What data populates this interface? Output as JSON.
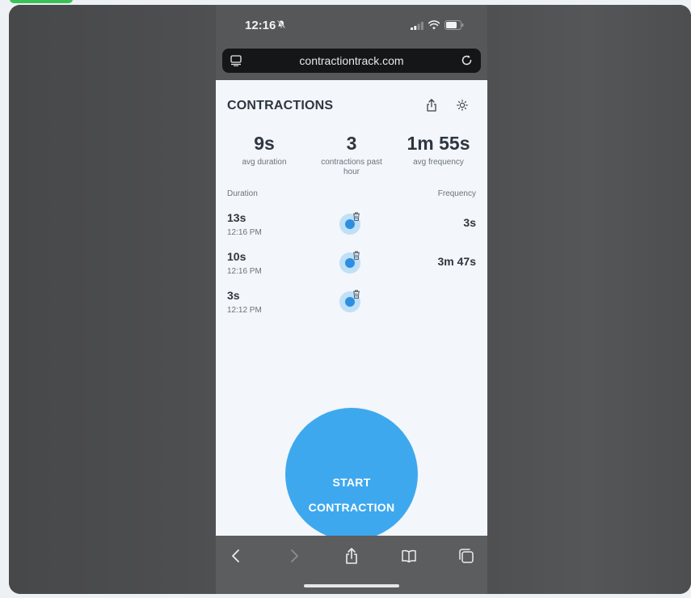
{
  "status_bar": {
    "time": "12:16"
  },
  "browser": {
    "url": "contractiontrack.com"
  },
  "app": {
    "title": "CONTRACTIONS",
    "stats": [
      {
        "value": "9s",
        "label": "avg duration"
      },
      {
        "value": "3",
        "label": "contractions past hour"
      },
      {
        "value": "1m 55s",
        "label": "avg frequency"
      }
    ],
    "columns": {
      "duration": "Duration",
      "frequency": "Frequency"
    },
    "contractions": [
      {
        "duration": "13s",
        "time": "12:16 PM",
        "frequency": "3s"
      },
      {
        "duration": "10s",
        "time": "12:16 PM",
        "frequency": "3m 47s"
      },
      {
        "duration": "3s",
        "time": "12:12 PM",
        "frequency": ""
      }
    ],
    "start_button": {
      "line1": "START",
      "line2": "CONTRACTION"
    }
  },
  "colors": {
    "accent": "#3ea8ee",
    "dot": "#2d8fe0",
    "text": "#2e3640",
    "app_bg": "#f3f6fa"
  },
  "icons": {
    "bell": "bell-slash-icon",
    "share": "share-icon",
    "theme": "sun-icon",
    "delete": "trash-icon"
  }
}
